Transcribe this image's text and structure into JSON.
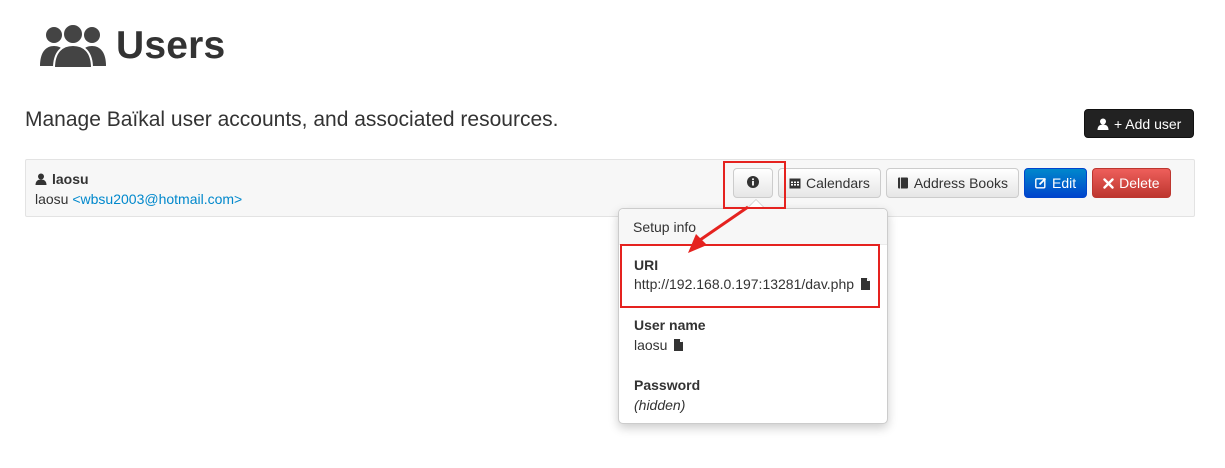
{
  "header": {
    "title": "Users",
    "icon": "users-icon"
  },
  "lead": "Manage Baïkal user accounts, and associated resources.",
  "add_user_button": {
    "label": "+ Add user",
    "icon": "user-icon"
  },
  "user": {
    "login": "laosu",
    "display_name": "laosu",
    "email": "<wbsu2003@hotmail.com>",
    "actions": {
      "info_icon": "info-circle-icon",
      "calendars": "Calendars",
      "address_books": "Address Books",
      "edit": "Edit",
      "delete": "Delete"
    }
  },
  "popover": {
    "title": "Setup info",
    "uri_label": "URI",
    "uri_value": "http://192.168.0.197:13281/dav.php",
    "username_label": "User name",
    "username_value": "laosu",
    "password_label": "Password",
    "password_value": "(hidden)"
  },
  "colors": {
    "annotation": "#e5221f",
    "link": "#0088cc",
    "primary": "#0044cc",
    "danger": "#bd362f",
    "inverse": "#222222"
  }
}
